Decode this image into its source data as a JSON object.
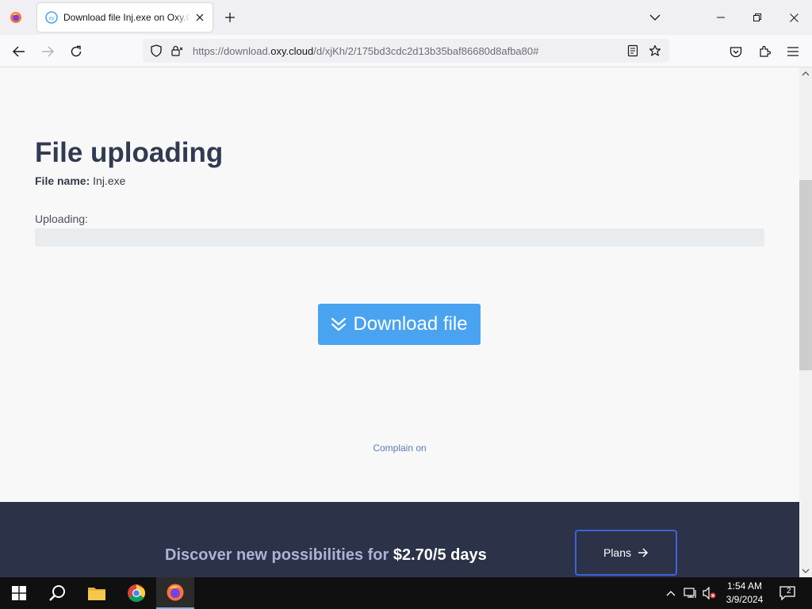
{
  "browser": {
    "tab_title": "Download file Inj.exe on Oxy.Cl",
    "url_prefix": "https://download.",
    "url_domain": "oxy.cloud",
    "url_path": "/d/xjKh/2/175bd3cdc2d13b35baf86680d8afba80#"
  },
  "page": {
    "title": "File uploading",
    "file_name_label": "File name:",
    "file_name": "Inj.exe",
    "uploading_label": "Uploading:",
    "upload_progress": 0,
    "download_button": "Download file",
    "complain_link": "Complain on",
    "promo_text": "Discover new possibilities for",
    "promo_price": "$2.70/5 days",
    "plans_button": "Plans"
  },
  "taskbar": {
    "time": "1:54 AM",
    "date": "3/9/2024",
    "notification_count": "2"
  },
  "colors": {
    "accent": "#4aa3f0",
    "title": "#323a52",
    "promo_bg": "#2c3248",
    "plans_border": "#3e63d6"
  }
}
